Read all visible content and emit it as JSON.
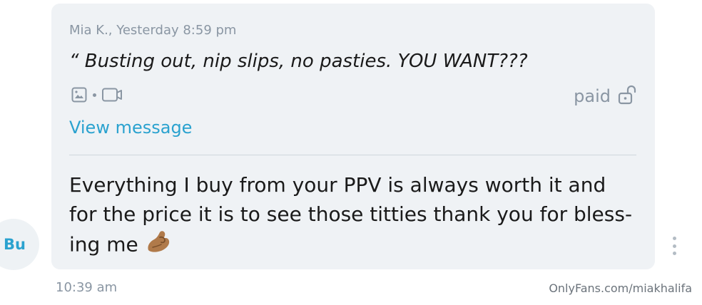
{
  "avatar": {
    "initials": "Bu"
  },
  "quoted": {
    "meta": "Mia K., Yesterday 8:59 pm",
    "text": "“ Busting out, nip slips, no pasties. YOU WANT???",
    "media_icons": [
      "image-icon",
      "video-icon"
    ],
    "paid_label": "paid",
    "view_link": "View message"
  },
  "reply": {
    "text": "Everything I buy from your PPV is always worth it and for the price it is to see those titties thank you for bless­ing me",
    "emoji": "pinched-fingers-emoji"
  },
  "timestamp": "10:39 am",
  "watermark": "OnlyFans.com/miakhalifa",
  "colors": {
    "bubble": "#eff2f5",
    "link": "#2aa2cf",
    "muted": "#8a96a3",
    "text": "#1a1a1a"
  }
}
